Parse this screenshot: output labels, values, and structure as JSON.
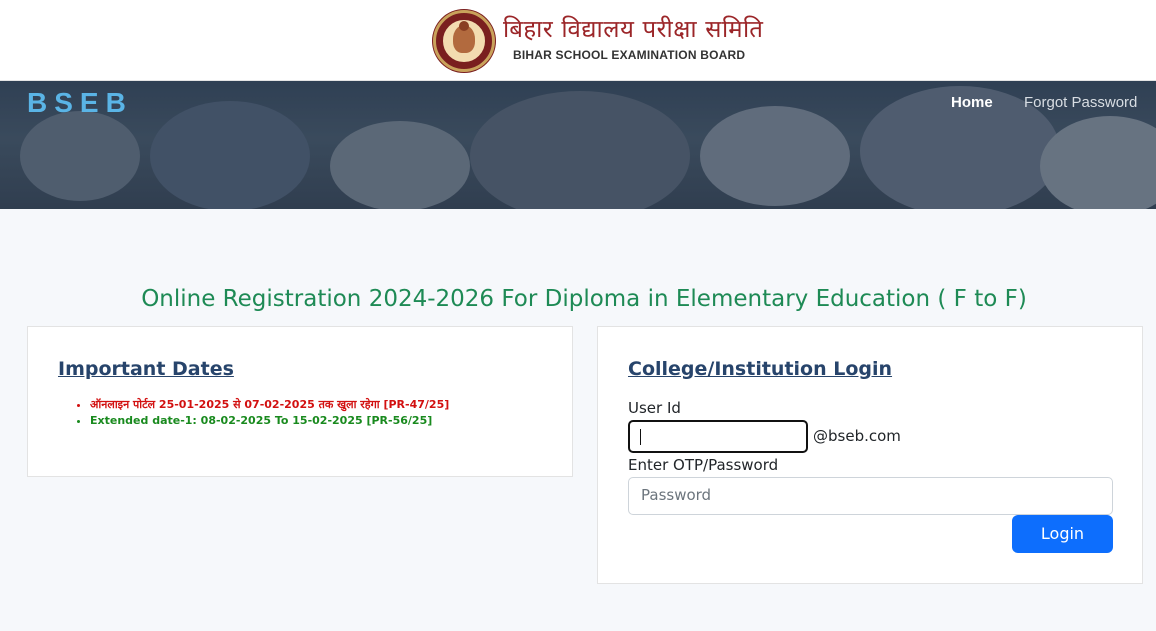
{
  "header": {
    "brand_hindi": "बिहार विद्यालय परीक्षा समिति",
    "brand_english": "BIHAR SCHOOL EXAMINATION BOARD",
    "logo_text": "BSEB"
  },
  "nav": {
    "home": "Home",
    "forgot_password": "Forgot Password"
  },
  "main": {
    "title": "Online Registration 2024-2026 For Diploma in Elementary Education ( F to F)"
  },
  "important_dates": {
    "heading": "Important Dates",
    "items": [
      {
        "text": "ऑनलाइन पोर्टल 25-01-2025 से 07-02-2025 तक खुला रहेगा [PR-47/25]",
        "color": "#d21010"
      },
      {
        "text": "Extended date-1: 08-02-2025 To 15-02-2025 [PR-56/25]",
        "color": "#198a1e"
      }
    ]
  },
  "login": {
    "heading": "College/Institution Login",
    "user_id_label": "User Id",
    "user_id_value": "",
    "user_id_suffix": "@bseb.com",
    "password_label": "Enter OTP/Password",
    "password_placeholder": "Password",
    "button_label": "Login"
  },
  "colors": {
    "title_green": "#1e8a55",
    "heading_navy": "#27446b",
    "logo_blue": "#5ab4e6",
    "button_blue": "#0d6efd",
    "brand_maroon": "#9b2528"
  }
}
